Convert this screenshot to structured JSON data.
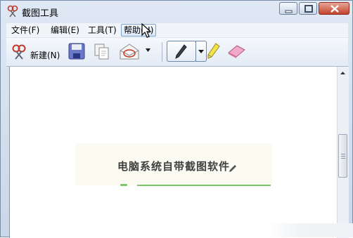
{
  "window": {
    "title": "截图工具",
    "icon": "snipping-tool-icon",
    "controls": [
      "minimize-icon",
      "maximize-icon",
      "close-icon"
    ]
  },
  "menu": {
    "items": [
      {
        "label": "文件(F)",
        "state": "normal"
      },
      {
        "label": "编辑(E)",
        "state": "normal"
      },
      {
        "label": "工具(T)",
        "state": "normal"
      },
      {
        "label": "帮助(H)",
        "state": "hover"
      }
    ]
  },
  "toolbar": {
    "new_label": "新建(N)",
    "icons": [
      "scissors-icon",
      "save-icon",
      "copy-icon",
      "send-email-icon",
      "dropdown-arrow-icon",
      "pen-icon",
      "highlighter-icon",
      "eraser-icon"
    ]
  },
  "canvas": {
    "caption": "电脑系统自带截图软件",
    "caption_icon": "pencil-icon"
  },
  "colors": {
    "titlebar": "#dfe8f4",
    "close_button": "#c2442c",
    "highlight_border": "#7da2ce",
    "caption_bg": "#fbfbf1",
    "accent_green": "#7bc46a"
  }
}
